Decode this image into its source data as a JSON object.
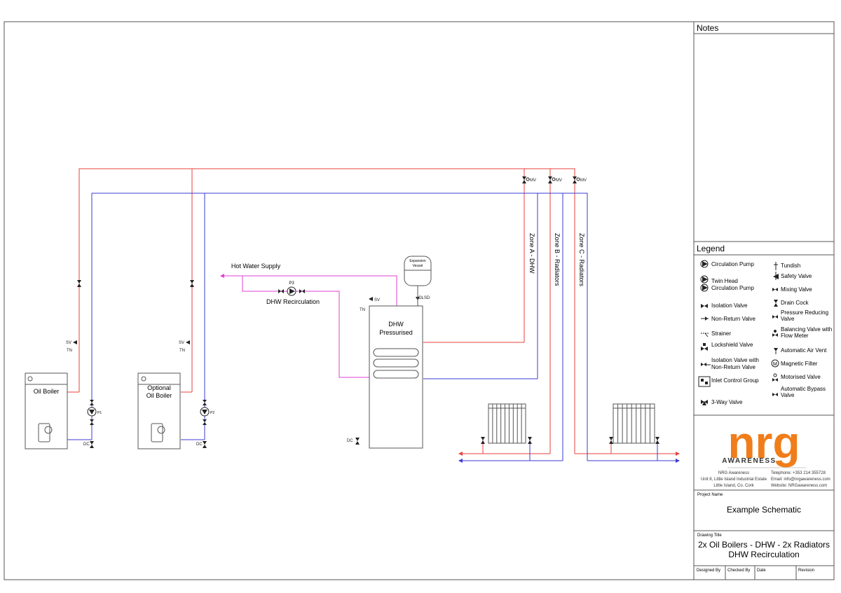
{
  "notes": {
    "title": "Notes"
  },
  "legend": {
    "title": "Legend",
    "left": [
      "Circulation Pump",
      "Twin Head",
      "Circulation Pump",
      "Isolation Valve",
      "Non-Return Valve",
      "Strainer",
      "Lockshield Valve",
      "Isolation Valve with",
      "Non-Return Valve",
      "Inlet Control Group",
      "3-Way Valve"
    ],
    "right": [
      "Tundish",
      "Safety Valve",
      "Mixing Valve",
      "Drain Cock",
      "Pressure Reducing",
      "Valve",
      "Balancing Valve with",
      "Flow Meter",
      "Automatic Air Vent",
      "Magnetic Filter",
      "Motorised Valve",
      "Automatic Bypass",
      "Valve"
    ],
    "magnetic_symbol": "M"
  },
  "company": {
    "logo_text": "nrg",
    "logo_sub": "AWARENESS",
    "address": [
      "NRG Awareness",
      "Unit 8, Little Island Industrial Estate",
      "Little Island, Co. Cork"
    ],
    "contact": [
      "Telephone: +353 214 355728",
      "Email: info@nrgawareness.com",
      "Website: NRGawareness.com"
    ],
    "accent_color": "#f07d1a"
  },
  "project": {
    "label": "Project Name",
    "name": "Example Schematic"
  },
  "drawing": {
    "label": "Drawing Title",
    "title_line1": "2x Oil Boilers - DHW - 2x Radiators",
    "title_line2": "DHW Recirculation"
  },
  "signoff": [
    "Designed By",
    "Checked By",
    "Date",
    "Revision"
  ],
  "diagram": {
    "boiler1": "Oil Boiler",
    "boiler2_line1": "Optional",
    "boiler2_line2": "Oil Boiler",
    "cylinder_line1": "DHW",
    "cylinder_line2": "Pressurised",
    "vessel_line1": "Expansion",
    "vessel_line2": "Vessel",
    "hot_water_supply": "Hot Water Supply",
    "recirc": "DHW Recirculation",
    "p3": "P3",
    "p1": "P1",
    "p2": "P2",
    "zone_a": "Zone A - DHW",
    "zone_b": "Zone B - Radiators",
    "zone_c": "Zone C - Radiators",
    "mv": "MV",
    "sv": "SV",
    "tn": "TN",
    "dc": "DC",
    "olsd": "OLSD",
    "flow_color": "#e8413c",
    "return_color": "#3b3bd6",
    "dhw_color": "#e23fd4"
  }
}
